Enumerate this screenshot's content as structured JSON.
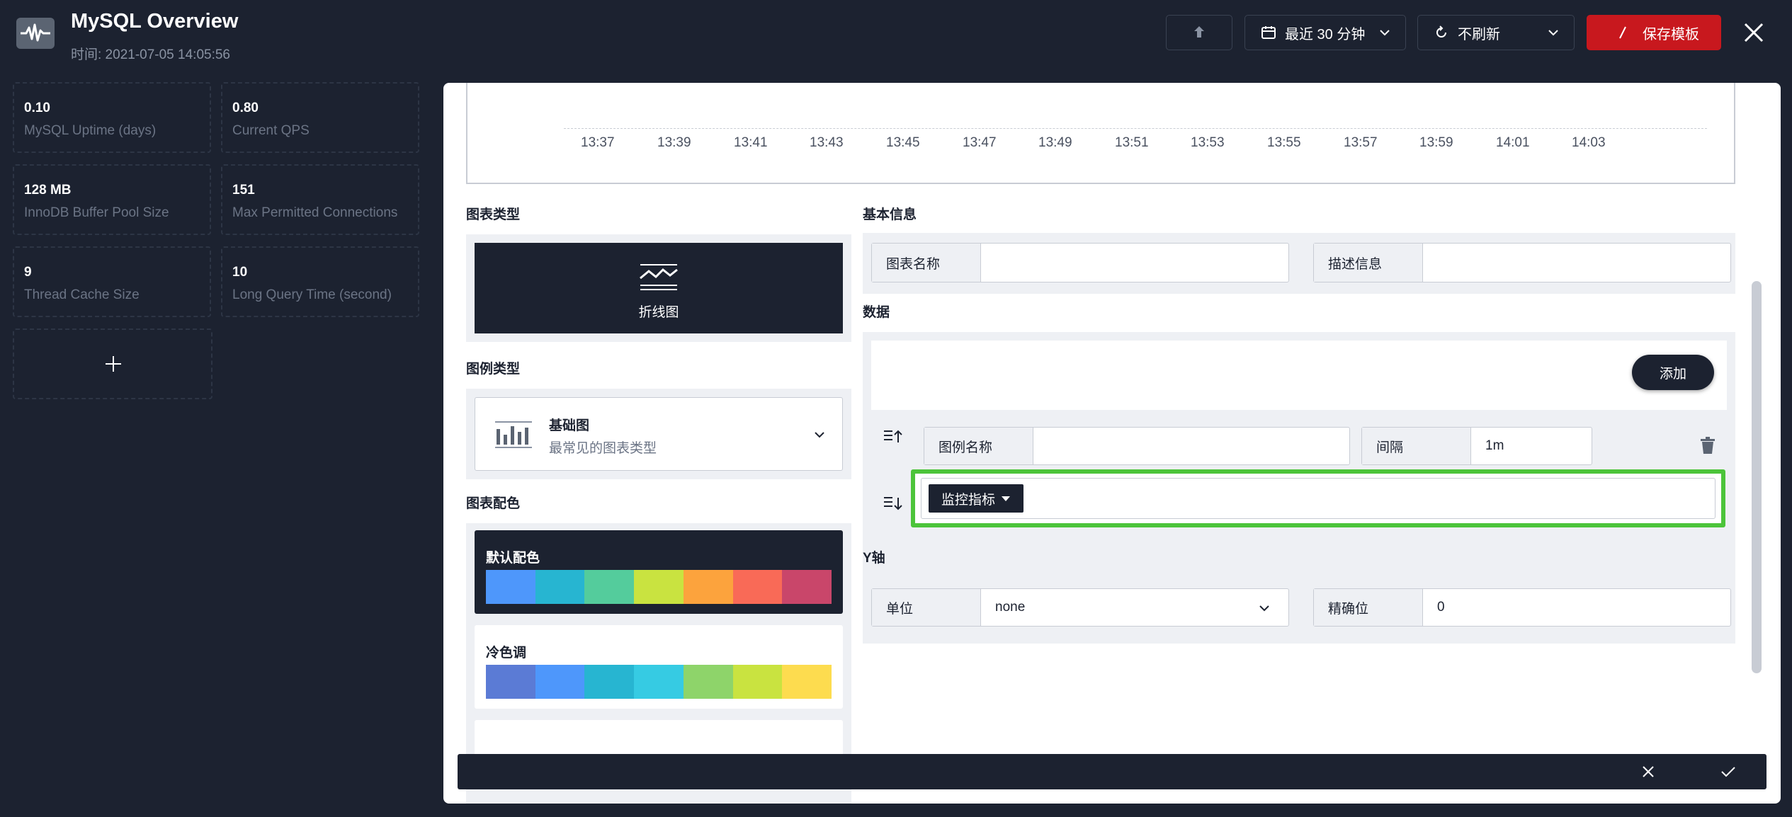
{
  "header": {
    "title": "MySQL Overview",
    "time": "时间: 2021-07-05 14:05:56",
    "time_range_label": "最近 30 分钟",
    "refresh_label": "不刷新",
    "save_label": "保存模板"
  },
  "stats": [
    {
      "value": "0.10",
      "label": "MySQL Uptime (days)"
    },
    {
      "value": "0.80",
      "label": "Current QPS"
    },
    {
      "value": "128 MB",
      "label": "InnoDB Buffer Pool Size"
    },
    {
      "value": "151",
      "label": "Max Permitted Connections"
    },
    {
      "value": "9",
      "label": "Thread Cache Size"
    },
    {
      "value": "10",
      "label": "Long Query Time (second)"
    }
  ],
  "preview": {
    "ticks": [
      "13:37",
      "13:39",
      "13:41",
      "13:43",
      "13:45",
      "13:47",
      "13:49",
      "13:51",
      "13:53",
      "13:55",
      "13:57",
      "13:59",
      "14:01",
      "14:03"
    ]
  },
  "chart_type": {
    "title": "图表类型",
    "selected": "折线图"
  },
  "legend_type": {
    "title": "图例类型",
    "name": "基础图",
    "desc": "最常见的图表类型"
  },
  "palettes": {
    "title": "图表配色",
    "items": [
      {
        "name": "默认配色",
        "colors": [
          "#4e97fb",
          "#27b5d1",
          "#54cc9c",
          "#c9e340",
          "#fca33d",
          "#f96a57",
          "#c9466a"
        ]
      },
      {
        "name": "冷色调",
        "colors": [
          "#5b7bd5",
          "#4e97fb",
          "#27b5d1",
          "#36cbe3",
          "#8ed46a",
          "#c9e340",
          "#fddc4f"
        ]
      }
    ]
  },
  "basic_info": {
    "title": "基本信息",
    "chart_name_label": "图表名称",
    "chart_name_value": "",
    "desc_label": "描述信息",
    "desc_value": ""
  },
  "data_section": {
    "title": "数据",
    "add_label": "添加",
    "legend_name_label": "图例名称",
    "legend_name_value": "",
    "interval_label": "间隔",
    "interval_value": "1m",
    "metric_label": "监控指标"
  },
  "y_axis": {
    "title": "Y轴",
    "unit_label": "单位",
    "unit_value": "none",
    "precision_label": "精确位",
    "precision_value": "0"
  }
}
